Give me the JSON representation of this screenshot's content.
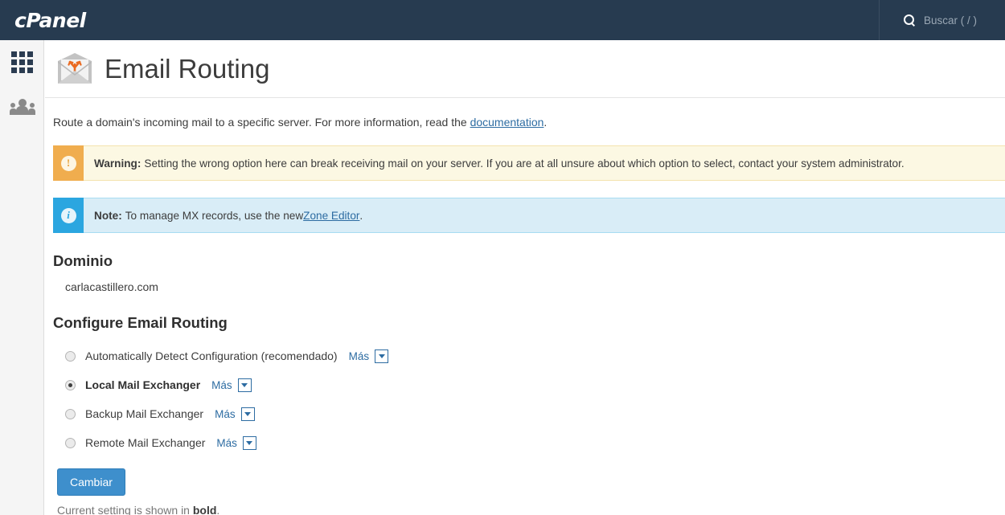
{
  "topbar": {
    "brand": "cPanel",
    "search_icon": "search-icon",
    "search_placeholder": "Buscar ( / )"
  },
  "sidebar": {
    "items": [
      {
        "icon": "grid-apps-icon",
        "name": "apps-grid"
      },
      {
        "icon": "users-icon",
        "name": "user-manager"
      }
    ]
  },
  "page": {
    "icon": "email-routing-envelope-icon",
    "title": "Email Routing",
    "intro_prefix": "Route a domain's incoming mail to a specific server. For more information, read the ",
    "intro_link": "documentation",
    "intro_suffix": "."
  },
  "alerts": [
    {
      "type": "warning",
      "icon": "exclamation-icon",
      "glyph": "!",
      "label": "Warning:",
      "text": " Setting the wrong option here can break receiving mail on your server. If you are at all unsure about which option to select, contact your system administrator."
    },
    {
      "type": "note",
      "icon": "info-icon",
      "glyph": "i",
      "label": "Note:",
      "text_before": " To manage MX records, use the new ",
      "link": "Zone Editor",
      "text_after": "."
    }
  ],
  "domain_section": {
    "heading": "Dominio",
    "value": "carlacastillero.com"
  },
  "configure_section": {
    "heading": "Configure Email Routing",
    "more_label": "Más",
    "options": [
      {
        "label": "Automatically Detect Configuration (recomendado)",
        "selected": false
      },
      {
        "label": "Local Mail Exchanger",
        "selected": true
      },
      {
        "label": "Backup Mail Exchanger",
        "selected": false
      },
      {
        "label": "Remote Mail Exchanger",
        "selected": false
      }
    ],
    "submit_label": "Cambiar",
    "footnote_prefix": "Current setting is shown in ",
    "footnote_bold": "bold",
    "footnote_suffix": "."
  },
  "colors": {
    "topbar_bg": "#273B50",
    "accent_blue": "#2d6ca2",
    "button_blue": "#3e8fcc",
    "warning_bg": "#fcf8e3",
    "warning_icon_bg": "#f0ad4e",
    "note_bg": "#d9edf7",
    "note_icon_bg": "#2ba6e0",
    "envelope_gray": "#c9c9c9",
    "routing_orange": "#ea6a21"
  }
}
